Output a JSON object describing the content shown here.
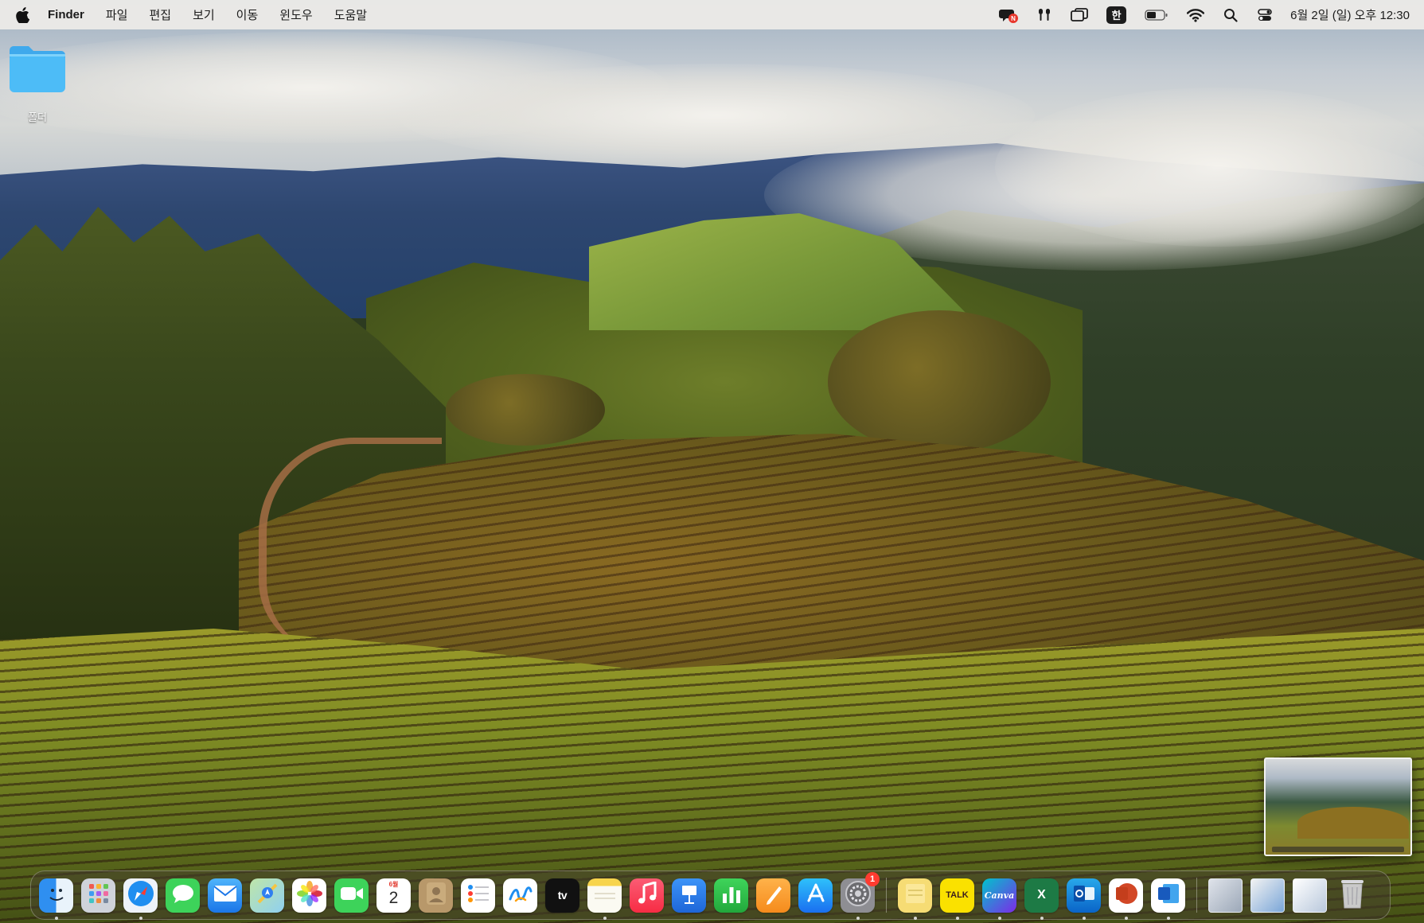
{
  "menubar": {
    "app_name": "Finder",
    "menus": [
      "파일",
      "편집",
      "보기",
      "이동",
      "윈도우",
      "도움말"
    ],
    "status": {
      "input_source": "한",
      "clock": "6월 2일 (일) 오후 12:30"
    },
    "icons": [
      "apple-logo-icon",
      "notification-app-icon",
      "airpods-icon",
      "screen-mirroring-icon",
      "input-source-icon",
      "battery-icon",
      "wifi-icon",
      "spotlight-search-icon",
      "control-center-icon"
    ]
  },
  "desktop": {
    "folder_label": "폴더"
  },
  "dock": {
    "apps": [
      {
        "name": "Finder",
        "icon": "finder-icon",
        "running": true
      },
      {
        "name": "Launchpad",
        "icon": "launchpad-icon",
        "running": false
      },
      {
        "name": "Safari",
        "icon": "safari-icon",
        "running": true
      },
      {
        "name": "Messages",
        "icon": "messages-icon",
        "running": false
      },
      {
        "name": "Mail",
        "icon": "mail-icon",
        "running": false
      },
      {
        "name": "Maps",
        "icon": "maps-icon",
        "running": false
      },
      {
        "name": "Photos",
        "icon": "photos-icon",
        "running": false
      },
      {
        "name": "FaceTime",
        "icon": "facetime-icon",
        "running": false
      },
      {
        "name": "Calendar",
        "icon": "calendar-icon",
        "running": false,
        "month": "6월",
        "day": "2"
      },
      {
        "name": "Contacts",
        "icon": "contacts-icon",
        "running": false
      },
      {
        "name": "Reminders",
        "icon": "reminders-icon",
        "running": false
      },
      {
        "name": "Freeform",
        "icon": "freeform-icon",
        "running": false
      },
      {
        "name": "TV",
        "icon": "apple-tv-icon",
        "running": false,
        "label": "tv"
      },
      {
        "name": "Notes",
        "icon": "notes-icon",
        "running": true
      },
      {
        "name": "Music",
        "icon": "music-icon",
        "running": false
      },
      {
        "name": "Keynote",
        "icon": "keynote-icon",
        "running": false
      },
      {
        "name": "Numbers",
        "icon": "numbers-icon",
        "running": false
      },
      {
        "name": "Pages",
        "icon": "pages-icon",
        "running": false
      },
      {
        "name": "App Store",
        "icon": "app-store-icon",
        "running": false
      },
      {
        "name": "System Settings",
        "icon": "system-settings-icon",
        "running": true,
        "badge": "1"
      },
      {
        "name": "Stickies",
        "icon": "stickies-icon",
        "running": true
      },
      {
        "name": "KakaoTalk",
        "icon": "kakaotalk-icon",
        "running": true,
        "label": "TALK"
      },
      {
        "name": "Canva",
        "icon": "canva-icon",
        "running": true,
        "label": "Canva"
      },
      {
        "name": "Microsoft Excel",
        "icon": "excel-icon",
        "running": true,
        "label": "X"
      },
      {
        "name": "Microsoft Outlook",
        "icon": "outlook-icon",
        "running": true
      },
      {
        "name": "Microsoft PowerPoint",
        "icon": "powerpoint-icon",
        "running": true,
        "label": "P"
      },
      {
        "name": "Microsoft Word",
        "icon": "word-icon",
        "running": true,
        "label": "W"
      }
    ],
    "stacks": [
      {
        "name": "Recent document",
        "icon": "recent-document-icon"
      },
      {
        "name": "Downloads stack",
        "icon": "downloads-stack-icon"
      },
      {
        "name": "Screenshots stack",
        "icon": "screenshots-stack-icon"
      },
      {
        "name": "Trash",
        "icon": "trash-icon"
      }
    ]
  },
  "colors": {
    "menubar_bg": "#eeece8",
    "folder_blue": "#49b6f5",
    "badge_red": "#ff3b30"
  }
}
